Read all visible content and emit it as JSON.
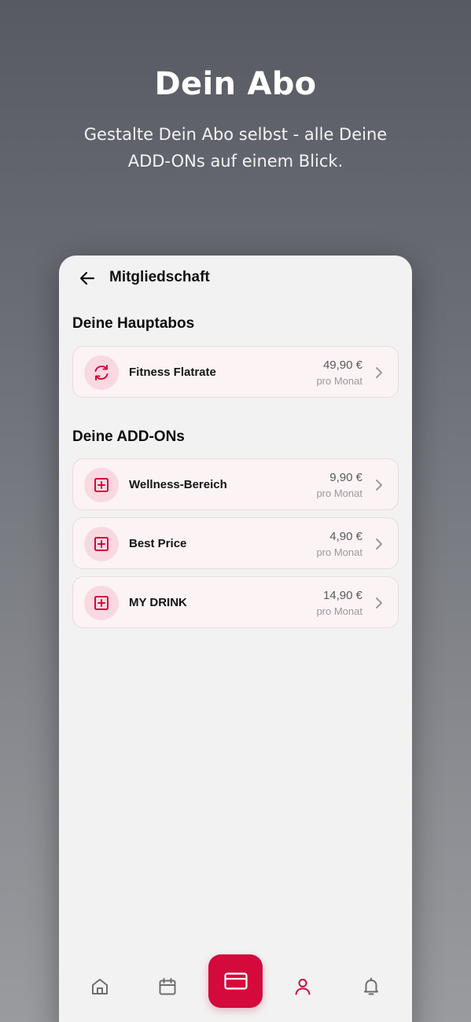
{
  "hero": {
    "title": "Dein Abo",
    "subtitle": "Gestalte Dein Abo selbst - alle Deine ADD-ONs auf einem Blick."
  },
  "screen": {
    "title": "Mitgliedschaft",
    "back_icon": "arrow-left-icon"
  },
  "main_section": {
    "title": "Deine Hauptabos",
    "items": [
      {
        "name": "Fitness Flatrate",
        "price": "49,90 €",
        "period": "pro Monat",
        "icon": "refresh-icon"
      }
    ]
  },
  "addon_section": {
    "title": "Deine ADD-ONs",
    "items": [
      {
        "name": "Wellness-Bereich",
        "price": "9,90 €",
        "period": "pro Monat",
        "icon": "plus-square-icon"
      },
      {
        "name": "Best Price",
        "price": "4,90 €",
        "period": "pro Monat",
        "icon": "plus-square-icon"
      },
      {
        "name": "MY DRINK",
        "price": "14,90 €",
        "period": "pro Monat",
        "icon": "plus-square-icon"
      }
    ]
  },
  "nav": {
    "items": [
      "home-icon",
      "calendar-icon",
      "card-icon",
      "profile-icon",
      "bell-icon"
    ],
    "active": "card-icon"
  },
  "colors": {
    "accent": "#d4093c",
    "badge_bg": "#f9d9e1",
    "card_bg": "#fcf3f5",
    "screen_bg": "#f2f2f2"
  }
}
